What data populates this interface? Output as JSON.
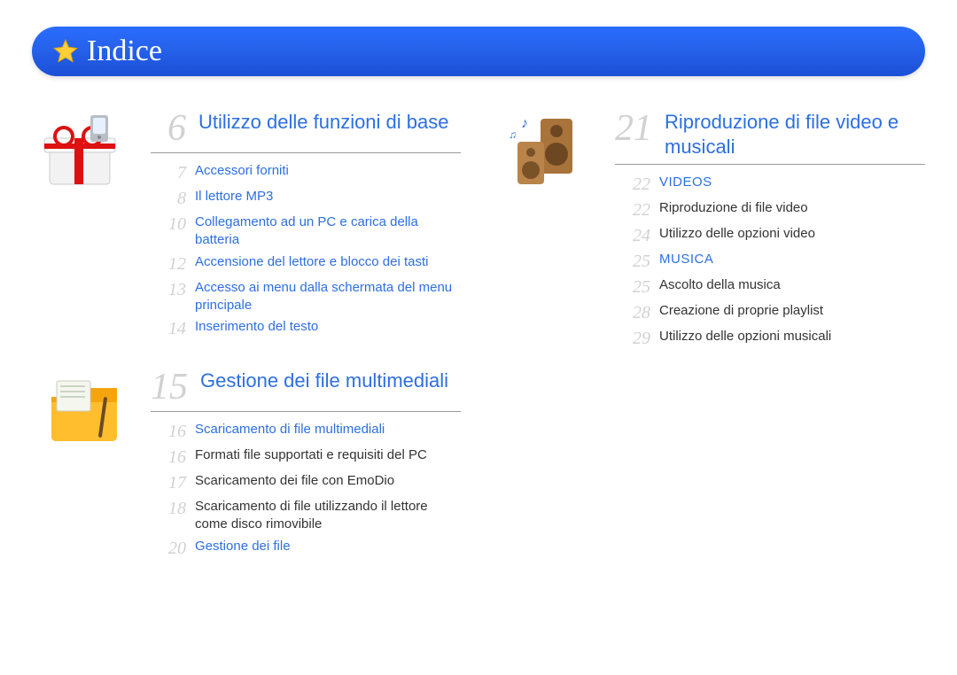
{
  "header": {
    "title": "Indice"
  },
  "columns": [
    {
      "blocks": [
        {
          "icon": "gift",
          "section": {
            "number": "6",
            "title": "Utilizzo delle funzioni di base"
          },
          "items": [
            {
              "num": "7",
              "text": "Accessori forniti",
              "style": "lvl1"
            },
            {
              "num": "8",
              "text": "Il lettore MP3",
              "style": "lvl1"
            },
            {
              "num": "10",
              "text": "Collegamento ad un PC e carica della batteria",
              "style": "lvl1"
            },
            {
              "num": "12",
              "text": "Accensione del lettore e blocco dei tasti",
              "style": "lvl1"
            },
            {
              "num": "13",
              "text": "Accesso ai menu dalla schermata del menu principale",
              "style": "lvl1"
            },
            {
              "num": "14",
              "text": "Inserimento del testo",
              "style": "lvl1"
            }
          ]
        },
        {
          "icon": "folder",
          "section": {
            "number": "15",
            "title": "Gestione dei file multimediali"
          },
          "items": [
            {
              "num": "16",
              "text": "Scaricamento di file multimediali",
              "style": "lvl1"
            },
            {
              "num": "16",
              "text": "Formati file supportati e requisiti del PC",
              "style": "lvl2"
            },
            {
              "num": "17",
              "text": "Scaricamento dei file con EmoDio",
              "style": "lvl2"
            },
            {
              "num": "18",
              "text": "Scaricamento di file utilizzando il lettore come disco rimovibile",
              "style": "lvl2"
            },
            {
              "num": "20",
              "text": "Gestione dei file",
              "style": "lvl1"
            }
          ]
        }
      ]
    },
    {
      "blocks": [
        {
          "icon": "speakers",
          "section": {
            "number": "21",
            "title": "Riproduzione di file video e musicali"
          },
          "items": [
            {
              "num": "22",
              "text": "VIDEOS",
              "style": "lvl1cap"
            },
            {
              "num": "22",
              "text": "Riproduzione di file video",
              "style": "lvl2"
            },
            {
              "num": "24",
              "text": "Utilizzo delle opzioni video",
              "style": "lvl2"
            },
            {
              "num": "25",
              "text": "MUSICA",
              "style": "lvl1cap"
            },
            {
              "num": "25",
              "text": "Ascolto della musica",
              "style": "lvl2"
            },
            {
              "num": "28",
              "text": "Creazione di proprie playlist",
              "style": "lvl2"
            },
            {
              "num": "29",
              "text": "Utilizzo delle opzioni musicali",
              "style": "lvl2"
            }
          ]
        }
      ]
    }
  ],
  "icons": {
    "gift": "gift-icon",
    "folder": "folder-icon",
    "speakers": "speakers-icon"
  }
}
